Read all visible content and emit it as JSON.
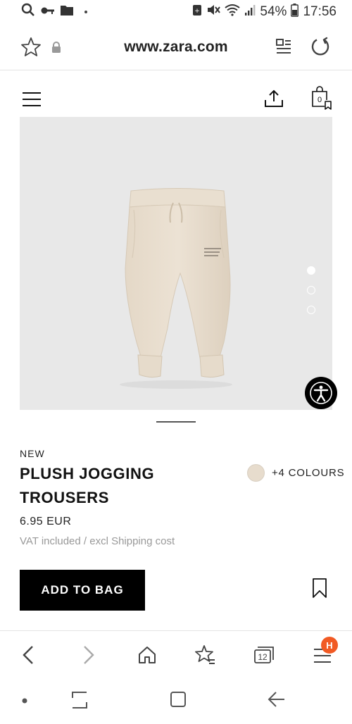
{
  "status_bar": {
    "battery": "54%",
    "time": "17:56"
  },
  "browser": {
    "url": "www.zara.com",
    "tab_count": "12",
    "profile_badge": "H"
  },
  "site_header": {
    "cart_count": "0"
  },
  "product": {
    "tag": "NEW",
    "title": "PLUSH JOGGING TROUSERS",
    "colours": "+4 COLOURS",
    "swatch_color": "#e7dccd",
    "price": "6.95 EUR",
    "vat_note": "VAT included / excl Shipping cost",
    "add_to_bag": "ADD TO BAG",
    "image_dots": 3,
    "active_image": 1
  },
  "colors": {
    "accent": "#000000",
    "badge": "#f15a24",
    "image_bg": "#e8e8e8"
  }
}
